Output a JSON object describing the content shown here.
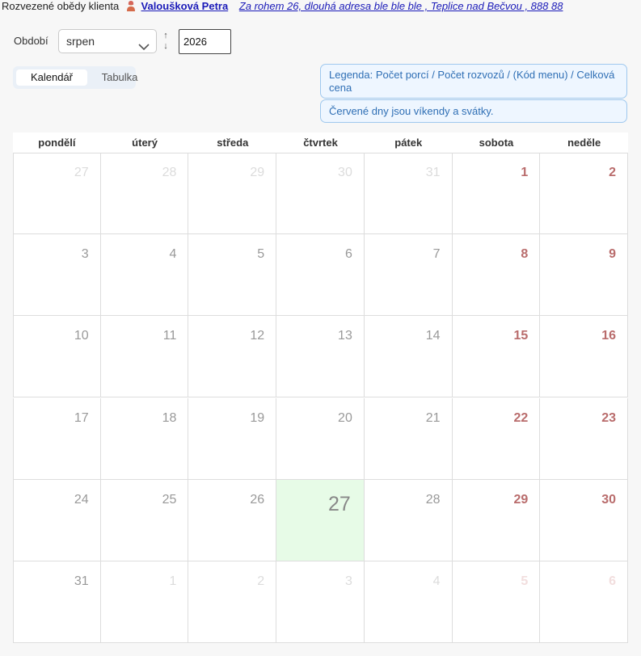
{
  "header": {
    "prefix": "Rozvezené obědy klienta",
    "client_name": "Valoušková Petra",
    "client_address": " Za rohem 26, dlouhá adresa ble ble ble , Teplice nad Bečvou , 888 88"
  },
  "period": {
    "label": "Období",
    "month": "srpen",
    "year": "2026",
    "stepper_up": "↑",
    "stepper_down": "↓"
  },
  "tabs": [
    {
      "label": "Kalendář",
      "active": true
    },
    {
      "label": "Tabulka",
      "active": false
    }
  ],
  "legend": {
    "line1": "Legenda: Počet porcí / Počet rozvozů / (Kód menu) / Celková cena",
    "line2": "Červené dny jsou víkendy a svátky."
  },
  "calendar": {
    "weekdays": [
      "pondělí",
      "úterý",
      "středa",
      "čtvrtek",
      "pátek",
      "sobota",
      "neděle"
    ],
    "weeks": [
      [
        {
          "d": "27",
          "o": true
        },
        {
          "d": "28",
          "o": true
        },
        {
          "d": "29",
          "o": true
        },
        {
          "d": "30",
          "o": true
        },
        {
          "d": "31",
          "o": true
        },
        {
          "d": "1"
        },
        {
          "d": "2"
        }
      ],
      [
        {
          "d": "3"
        },
        {
          "d": "4"
        },
        {
          "d": "5"
        },
        {
          "d": "6"
        },
        {
          "d": "7"
        },
        {
          "d": "8"
        },
        {
          "d": "9"
        }
      ],
      [
        {
          "d": "10"
        },
        {
          "d": "11"
        },
        {
          "d": "12"
        },
        {
          "d": "13"
        },
        {
          "d": "14"
        },
        {
          "d": "15"
        },
        {
          "d": "16"
        }
      ],
      [
        {
          "d": "17"
        },
        {
          "d": "18"
        },
        {
          "d": "19"
        },
        {
          "d": "20"
        },
        {
          "d": "21"
        },
        {
          "d": "22"
        },
        {
          "d": "23"
        }
      ],
      [
        {
          "d": "24"
        },
        {
          "d": "25"
        },
        {
          "d": "26"
        },
        {
          "d": "27",
          "today": true
        },
        {
          "d": "28"
        },
        {
          "d": "29"
        },
        {
          "d": "30"
        }
      ],
      [
        {
          "d": "31"
        },
        {
          "d": "1",
          "o": true
        },
        {
          "d": "2",
          "o": true
        },
        {
          "d": "3",
          "o": true
        },
        {
          "d": "4",
          "o": true
        },
        {
          "d": "5",
          "o": true
        },
        {
          "d": "6",
          "o": true
        }
      ]
    ],
    "colors": {
      "weekend": "#b96c6c",
      "today_bg": "#e7fbe7",
      "other_month": "#dcdcdc"
    }
  },
  "icons": {
    "avatar": "person-avatar-icon",
    "select": "chevron-down-icon"
  }
}
